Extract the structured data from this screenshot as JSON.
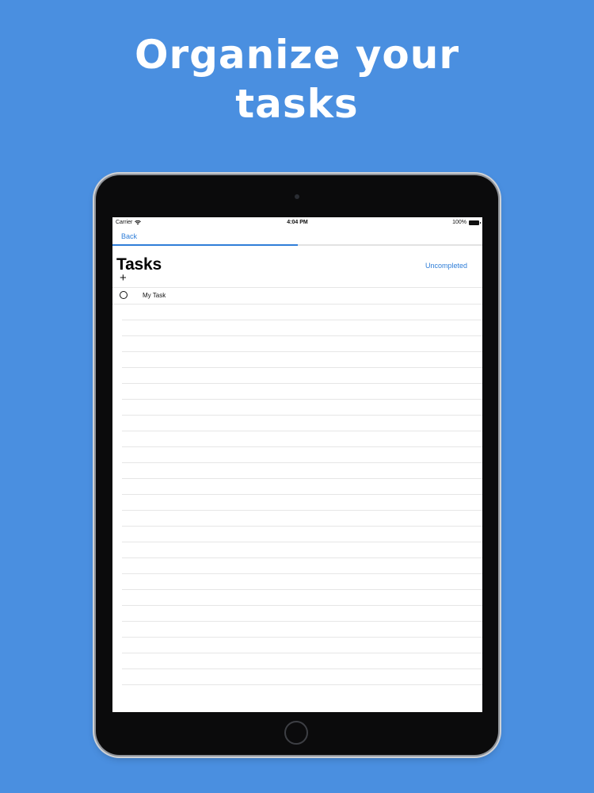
{
  "headline": "Organize your\ntasks",
  "status_bar": {
    "carrier": "Carrier",
    "time": "4:04 PM",
    "battery": "100%"
  },
  "nav": {
    "back_label": "Back",
    "progress": 0.5
  },
  "header": {
    "title": "Tasks",
    "filter_label": "Uncompleted",
    "add_glyph": "+"
  },
  "tasks": [
    {
      "title": "My Task",
      "completed": false
    }
  ],
  "colors": {
    "background": "#4a8fe0",
    "accent": "#2f7ed8"
  }
}
